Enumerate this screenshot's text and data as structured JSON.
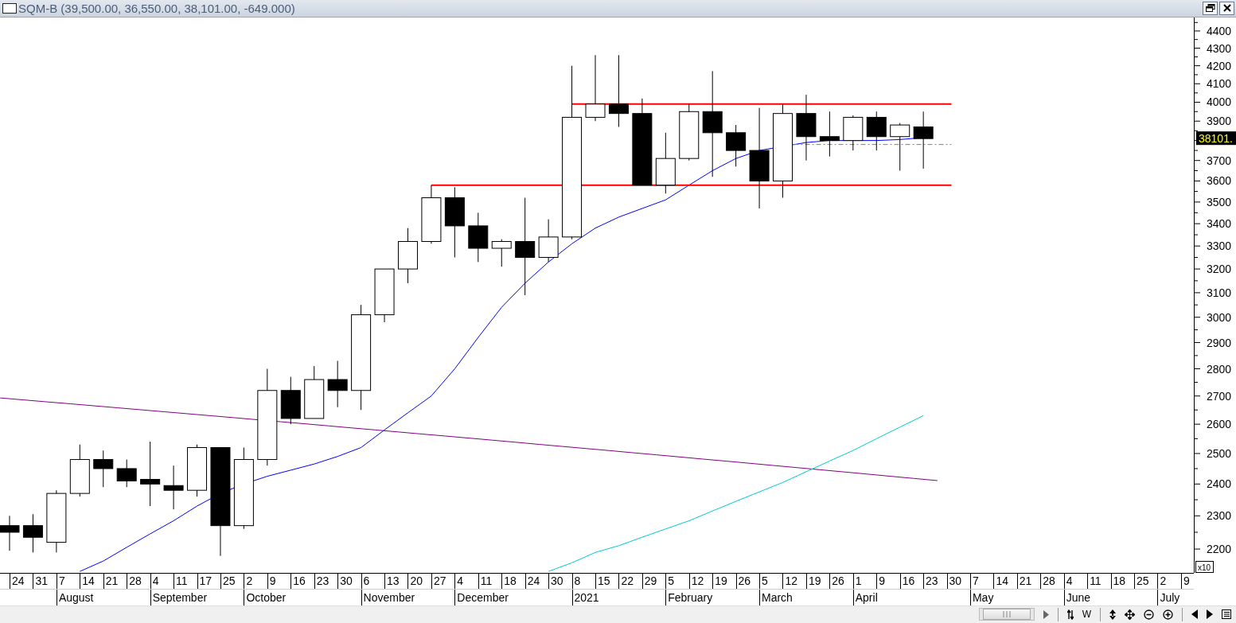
{
  "window": {
    "title": "SQM-B (39,500.00, 36,550.00, 38,101.00, -649.000)"
  },
  "chart": {
    "price_axis_labels": [
      "4400",
      "4300",
      "4200",
      "4100",
      "4000",
      "3900",
      "3700",
      "3600",
      "3500",
      "3400",
      "3300",
      "3200",
      "3100",
      "3000",
      "2900",
      "2800",
      "2700",
      "2600",
      "2500",
      "2400",
      "2300",
      "2200"
    ],
    "price_marker": "38101.",
    "scale_label": "x10",
    "weeks": [
      {
        "label": "24"
      },
      {
        "label": "31"
      },
      {
        "label": "7",
        "month": "August"
      },
      {
        "label": "14"
      },
      {
        "label": "21"
      },
      {
        "label": "28"
      },
      {
        "label": "4",
        "month": "September"
      },
      {
        "label": "11"
      },
      {
        "label": "17"
      },
      {
        "label": "25"
      },
      {
        "label": "2",
        "month": "October"
      },
      {
        "label": "9"
      },
      {
        "label": "16"
      },
      {
        "label": "23"
      },
      {
        "label": "30"
      },
      {
        "label": "6",
        "month": "November"
      },
      {
        "label": "13"
      },
      {
        "label": "20"
      },
      {
        "label": "27"
      },
      {
        "label": "4",
        "month": "December"
      },
      {
        "label": "11"
      },
      {
        "label": "18"
      },
      {
        "label": "24"
      },
      {
        "label": "30"
      },
      {
        "label": "8",
        "month": "2021"
      },
      {
        "label": "15"
      },
      {
        "label": "22"
      },
      {
        "label": "29"
      },
      {
        "label": "5",
        "month": "February"
      },
      {
        "label": "12"
      },
      {
        "label": "19"
      },
      {
        "label": "26"
      },
      {
        "label": "5",
        "month": "March"
      },
      {
        "label": "12"
      },
      {
        "label": "19"
      },
      {
        "label": "26"
      },
      {
        "label": "1",
        "month": "April"
      },
      {
        "label": "9"
      },
      {
        "label": "16"
      },
      {
        "label": "23"
      },
      {
        "label": "30"
      },
      {
        "label": "7",
        "month": "May"
      },
      {
        "label": "14"
      },
      {
        "label": "21"
      },
      {
        "label": "28"
      },
      {
        "label": "4",
        "month": "June"
      },
      {
        "label": "11"
      },
      {
        "label": "18"
      },
      {
        "label": "25"
      },
      {
        "label": "2",
        "month": "July"
      },
      {
        "label": "9"
      }
    ]
  },
  "toolbar": {
    "buttons": [
      {
        "kind": "text",
        "label": "W"
      }
    ]
  }
}
